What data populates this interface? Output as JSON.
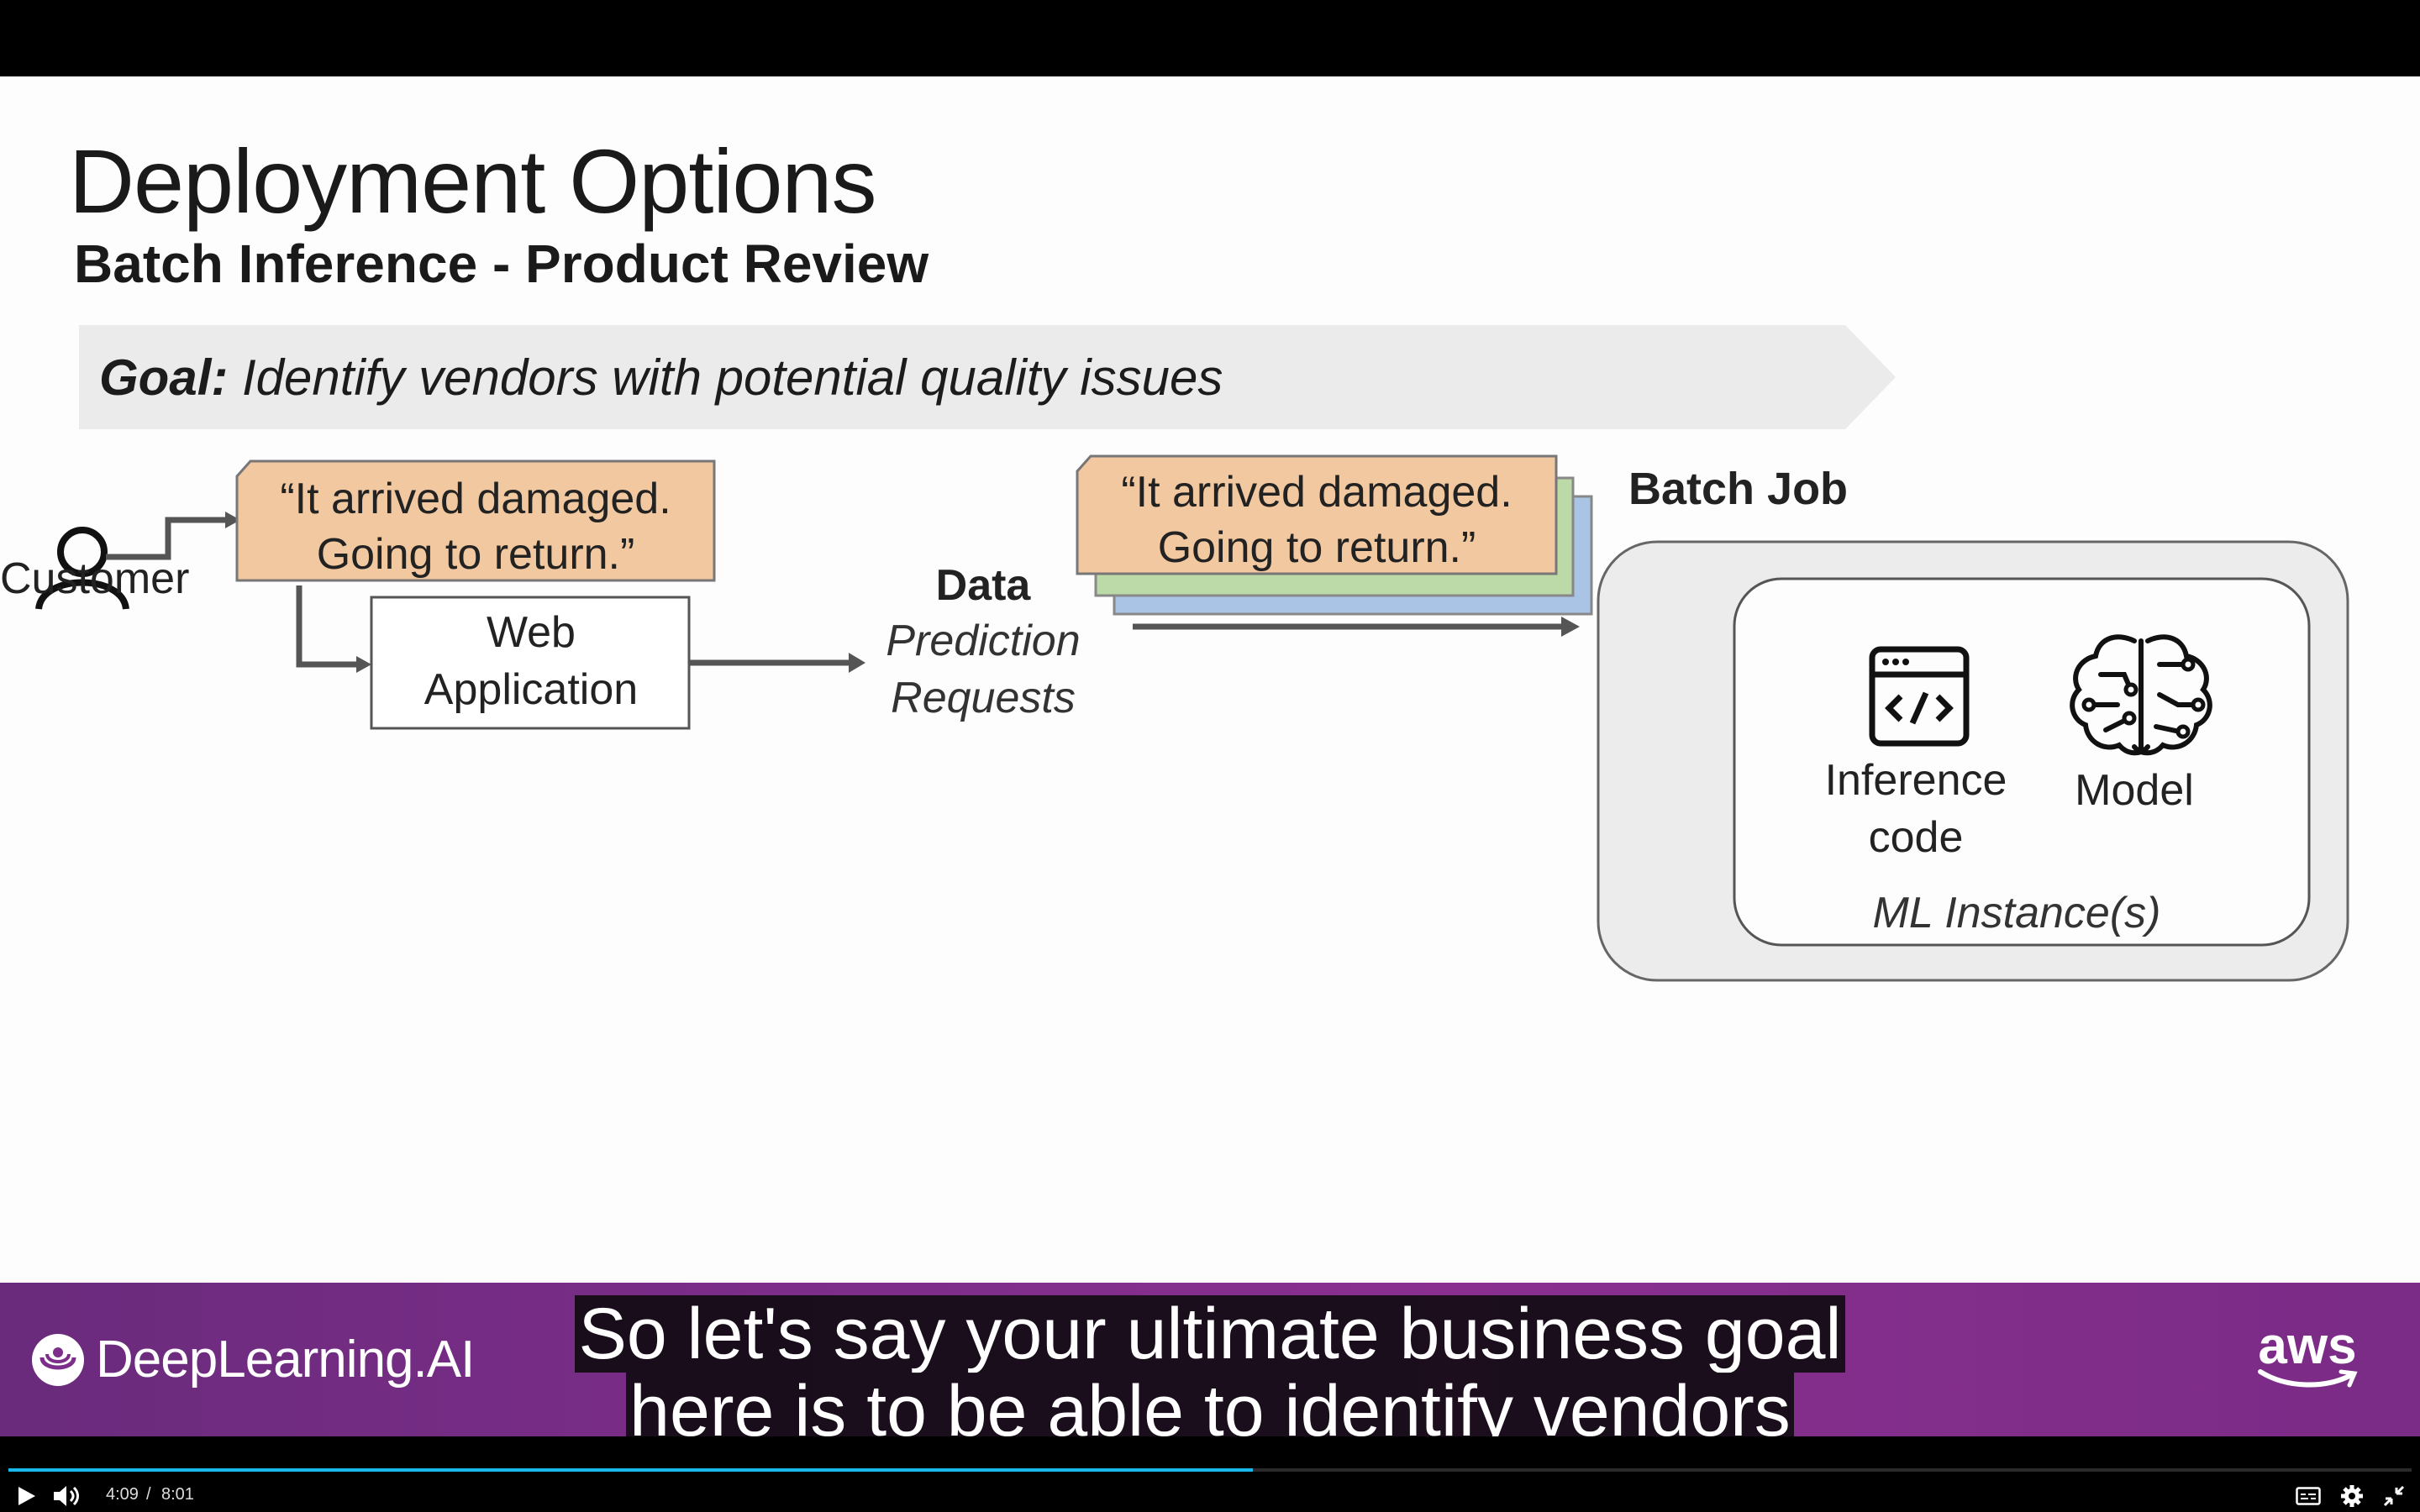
{
  "slide": {
    "title": "Deployment Options",
    "subtitle": "Batch Inference - Product Review",
    "goal_prefix": "Goal:",
    "goal_text": " Identify vendors with potential quality issues",
    "customer_label": "Customer",
    "review_line1": "“It arrived damaged.",
    "review_line2": "Going to return.”",
    "webapp_line1": "Web",
    "webapp_line2": "Application",
    "data_label": "Data",
    "prediction_line1": "Prediction",
    "prediction_line2": "Requests",
    "batch_quote_line1": "“It arrived damaged.",
    "batch_quote_line2": "Going to return.”",
    "batch_job_label": "Batch Job",
    "inference_line1": "Inference",
    "inference_line2": "code",
    "model_label": "Model",
    "ml_instance_label": "ML Instance(s)",
    "colors": {
      "review_box": "#f2c8a0",
      "stack_green": "#bcd9a8",
      "stack_blue": "#aac4e6",
      "goal_banner": "#ebebeb",
      "batch_outer": "#ececec"
    }
  },
  "banner": {
    "brand": "DeepLearning.AI",
    "partner": "aws",
    "brand_icon": "deeplearning-logo-icon",
    "partner_icon": "aws-smile-icon"
  },
  "captions": {
    "line1": "So let's say your ultimate business goal",
    "line2": "here is to be able to identify vendors"
  },
  "player": {
    "current_time": "4:09",
    "separator": "/",
    "duration": "8:01",
    "progress": 0.518,
    "accent": "#1ab7ea"
  }
}
